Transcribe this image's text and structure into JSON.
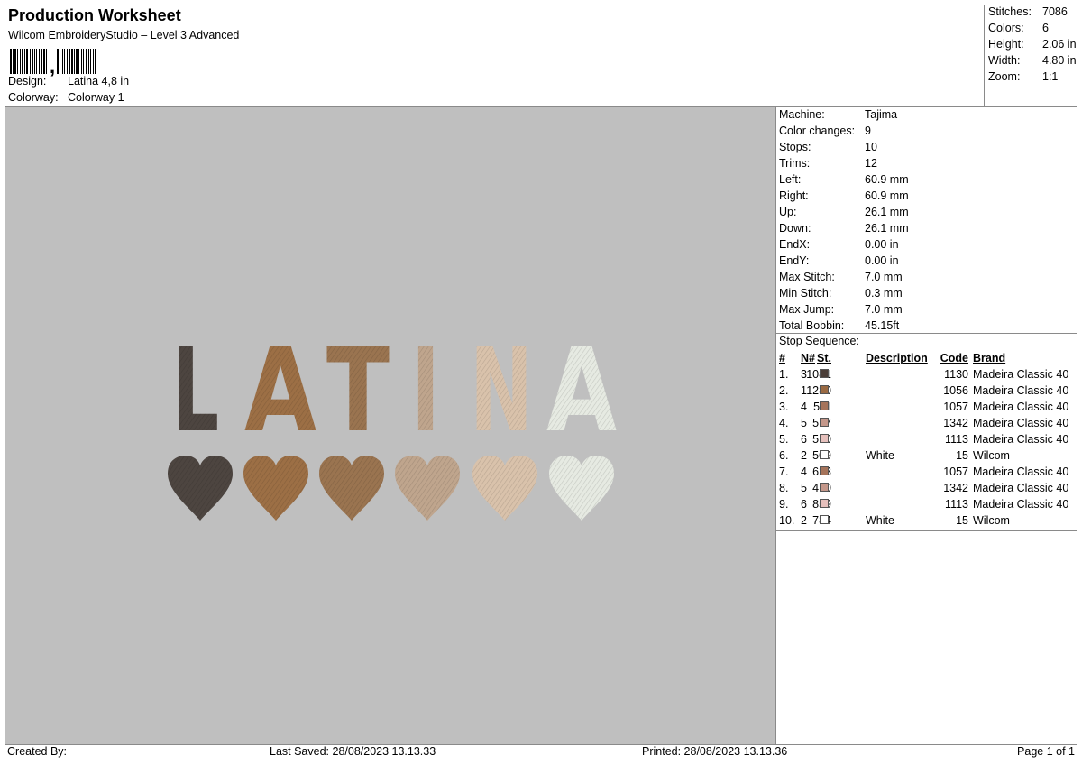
{
  "header": {
    "title": "Production Worksheet",
    "subtitle": "Wilcom EmbroideryStudio – Level 3 Advanced",
    "design_label": "Design:",
    "design_value": "Latina 4,8 in",
    "colorway_label": "Colorway:",
    "colorway_value": "Colorway 1"
  },
  "stats": {
    "stitches_label": "Stitches:",
    "stitches": "7086",
    "colors_label": "Colors:",
    "colors": "6",
    "height_label": "Height:",
    "height": "2.06 in",
    "width_label": "Width:",
    "width": "4.80 in",
    "zoom_label": "Zoom:",
    "zoom": "1:1"
  },
  "machine": [
    {
      "label": "Machine:",
      "value": "Tajima"
    },
    {
      "label": "Color changes:",
      "value": "9"
    },
    {
      "label": "Stops:",
      "value": "10"
    },
    {
      "label": "Trims:",
      "value": "12"
    },
    {
      "label": "Left:",
      "value": "60.9 mm"
    },
    {
      "label": "Right:",
      "value": "60.9 mm"
    },
    {
      "label": "Up:",
      "value": "26.1 mm"
    },
    {
      "label": "Down:",
      "value": "26.1 mm"
    },
    {
      "label": "EndX:",
      "value": "0.00 in"
    },
    {
      "label": "EndY:",
      "value": "0.00 in"
    },
    {
      "label": "Max Stitch:",
      "value": "7.0 mm"
    },
    {
      "label": "Min Stitch:",
      "value": "0.3 mm"
    },
    {
      "label": "Max Jump:",
      "value": "7.0 mm"
    },
    {
      "label": "Total Bobbin:",
      "value": "45.15ft"
    }
  ],
  "stop_sequence": {
    "title": "Stop Sequence:",
    "headers": {
      "idx": "#",
      "n": "N#",
      "st": "St.",
      "desc": "Description",
      "code": "Code",
      "brand": "Brand"
    },
    "rows": [
      {
        "idx": "1.",
        "n": "3",
        "color": "#4a3d37",
        "st": "1081",
        "desc": "",
        "code": "1130",
        "brand": "Madeira Classic 40"
      },
      {
        "idx": "2.",
        "n": "1",
        "color": "#9a6a43",
        "st": "1280",
        "desc": "",
        "code": "1056",
        "brand": "Madeira Classic 40"
      },
      {
        "idx": "3.",
        "n": "4",
        "color": "#a5735a",
        "st": "511",
        "desc": "",
        "code": "1057",
        "brand": "Madeira Classic 40"
      },
      {
        "idx": "4.",
        "n": "5",
        "color": "#c4978a",
        "st": "517",
        "desc": "",
        "code": "1342",
        "brand": "Madeira Classic 40"
      },
      {
        "idx": "5.",
        "n": "6",
        "color": "#e6c0bc",
        "st": "510",
        "desc": "",
        "code": "1113",
        "brand": "Madeira Classic 40"
      },
      {
        "idx": "6.",
        "n": "2",
        "color": "#ffffff",
        "st": "509",
        "desc": "White",
        "code": "15",
        "brand": "Wilcom"
      },
      {
        "idx": "7.",
        "n": "4",
        "color": "#a5735a",
        "st": "623",
        "desc": "",
        "code": "1057",
        "brand": "Madeira Classic 40"
      },
      {
        "idx": "8.",
        "n": "5",
        "color": "#c4978a",
        "st": "410",
        "desc": "",
        "code": "1342",
        "brand": "Madeira Classic 40"
      },
      {
        "idx": "9.",
        "n": "6",
        "color": "#e6c0bc",
        "st": "859",
        "desc": "",
        "code": "1113",
        "brand": "Madeira Classic 40"
      },
      {
        "idx": "10.",
        "n": "2",
        "color": "#ffffff",
        "st": "784",
        "desc": "White",
        "code": "15",
        "brand": "Wilcom"
      }
    ]
  },
  "preview": {
    "letters": [
      "L",
      "A",
      "T",
      "I",
      "N",
      "A"
    ],
    "letter_colors": [
      "#4d4540",
      "#9c6f45",
      "#9a7450",
      "#bfa58d",
      "#d9c2ab",
      "#e6eae2"
    ],
    "heart_colors": [
      "#4d4540",
      "#9c6f45",
      "#9a7450",
      "#bfa58d",
      "#d9c2ab",
      "#e6eae2"
    ]
  },
  "footer": {
    "created_by": "Created By:",
    "last_saved": "Last Saved: 28/08/2023 13.13.33",
    "printed": "Printed: 28/08/2023 13.13.36",
    "page": "Page 1 of 1"
  }
}
